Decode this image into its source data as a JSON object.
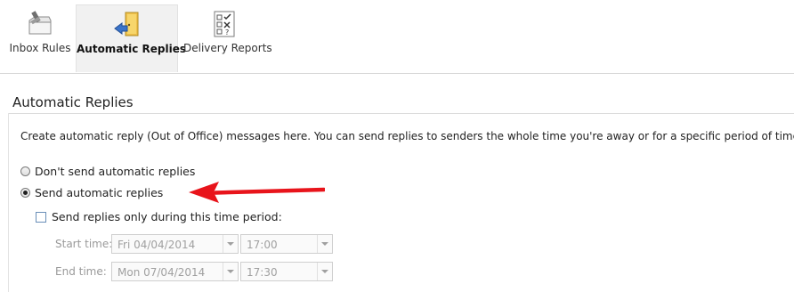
{
  "ribbon": {
    "inbox_rules": "Inbox Rules",
    "automatic_replies": "Automatic Replies",
    "delivery_reports": "Delivery Reports"
  },
  "section": {
    "title": "Automatic Replies",
    "description": "Create automatic reply (Out of Office) messages here. You can send replies to senders the whole time you're away or for a specific period of time."
  },
  "options": {
    "dont_send": "Don't send automatic replies",
    "send": "Send automatic replies",
    "selected": "send",
    "time_period_label": "Send replies only during this time period:",
    "time_period_checked": false
  },
  "schedule": {
    "start_label": "Start time:",
    "start_date": "Fri 04/04/2014",
    "start_time": "17:00",
    "end_label": "End time:",
    "end_date": "Mon 07/04/2014",
    "end_time": "17:30"
  },
  "annotation": {
    "arrow_color": "#e8141b"
  }
}
